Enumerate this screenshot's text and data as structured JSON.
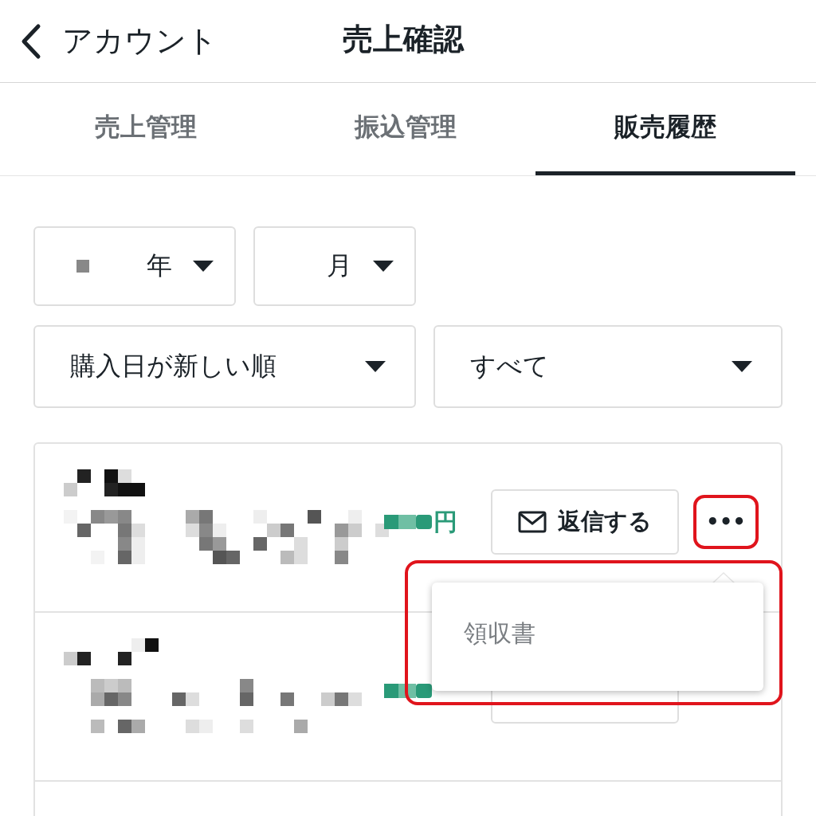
{
  "header": {
    "back_label": "アカウント",
    "title": "売上確認"
  },
  "tabs": [
    {
      "label": "売上管理",
      "selected": false
    },
    {
      "label": "振込管理",
      "selected": false
    },
    {
      "label": "販売履歴",
      "selected": true
    }
  ],
  "filters": [
    {
      "kind": "year",
      "label": "年",
      "redacted": true
    },
    {
      "kind": "month",
      "label": "月",
      "redacted": false
    },
    {
      "kind": "sort",
      "label": "購入日が新しい順",
      "redacted": false
    },
    {
      "kind": "status",
      "label": "すべて",
      "redacted": false
    }
  ],
  "sales": [
    {
      "currency": "円",
      "reply_label": "返信する",
      "more_label": "•••",
      "highlighted": true
    },
    {
      "covered": true
    }
  ],
  "popup_menu": {
    "items": [
      "領収書"
    ],
    "highlighted": true
  }
}
